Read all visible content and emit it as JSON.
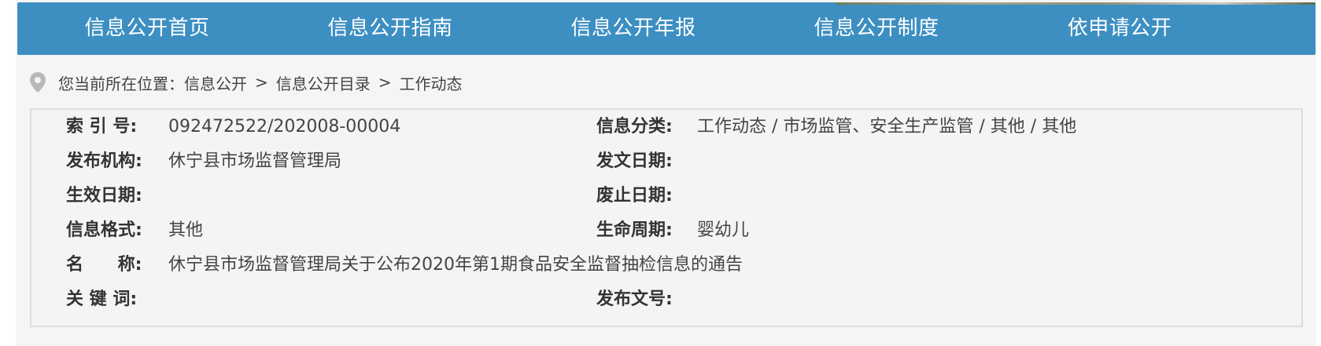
{
  "nav": {
    "items": [
      {
        "label": "信息公开首页"
      },
      {
        "label": "信息公开指南"
      },
      {
        "label": "信息公开年报"
      },
      {
        "label": "信息公开制度"
      },
      {
        "label": "依申请公开"
      }
    ]
  },
  "breadcrumb": {
    "prefix": "您当前所在位置：",
    "items": [
      "信息公开",
      "信息公开目录",
      "工作动态"
    ],
    "separator": ">",
    "icon": "location-pin-icon"
  },
  "meta": {
    "index_no": {
      "label": "索 引 号:",
      "value": "092472522/202008-00004"
    },
    "category": {
      "label": "信息分类:",
      "value": "工作动态 / 市场监管、安全生产监管 / 其他 / 其他"
    },
    "publisher": {
      "label": "发布机构:",
      "value": "休宁县市场监督管理局"
    },
    "issue_date": {
      "label": "发文日期:",
      "value": ""
    },
    "effective_date": {
      "label": "生效日期:",
      "value": ""
    },
    "expiry_date": {
      "label": "废止日期:",
      "value": ""
    },
    "format": {
      "label": "信息格式:",
      "value": "其他"
    },
    "life_cycle": {
      "label": "生命周期:",
      "value": "婴幼儿"
    },
    "title": {
      "label": "名 称:",
      "value": "休宁县市场监督管理局关于公布2020年第1期食品安全监督抽检信息的通告"
    },
    "keywords": {
      "label": "关 键 词:",
      "value": ""
    },
    "doc_number": {
      "label": "发布文号:",
      "value": ""
    }
  },
  "colors": {
    "nav_bg": "#3d8fc2",
    "page_bg": "#f5f5f5",
    "box_border": "#dddddd"
  }
}
